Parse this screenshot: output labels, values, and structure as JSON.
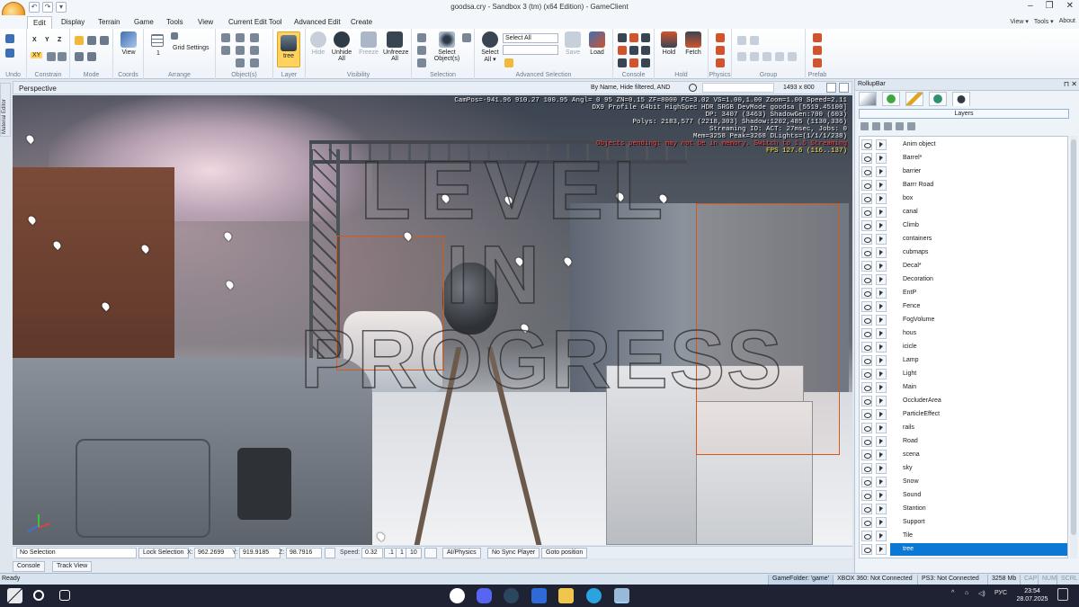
{
  "window": {
    "title": "goodsa.cry - Sandbox 3 (tm) (x64 Edition) - GameClient"
  },
  "ribbon": {
    "tabs": [
      "Edit",
      "Display",
      "Terrain",
      "Game",
      "Tools",
      "View",
      "Current Edit Tool",
      "Advanced Edit",
      "Create"
    ],
    "right_items": [
      "View ▾",
      "Tools ▾",
      "About"
    ],
    "groups": {
      "undo": "Undo",
      "constrain": "Constrain",
      "mode": "Mode",
      "coords": "Coords",
      "arrange": "Arrange",
      "objects": "Object(s)",
      "layer": "Layer",
      "visibility": "Visibility",
      "selection": "Selection",
      "advanced_selection": "Advanced Selection",
      "console": "Console",
      "hold": "Hold",
      "physics": "Physics",
      "group": "Group",
      "prefab": "Prefab"
    },
    "buttons": {
      "view": "View",
      "grid_settings": "Grid Settings",
      "one": "1",
      "tree": "tree",
      "hide": "Hide",
      "unhide_all_1": "Unhide",
      "unhide_all_2": "All",
      "freeze": "Freeze",
      "unfreeze_all_1": "Unfreeze",
      "unfreeze_all_2": "All",
      "select_objects_1": "Select",
      "select_objects_2": "Object(s)",
      "select_all_1": "Select",
      "select_all_2": "All ▾",
      "save": "Save",
      "load": "Load",
      "hold": "Hold",
      "fetch": "Fetch"
    },
    "select_all_combo": "Select All",
    "xyz": [
      "X",
      "Y",
      "Z"
    ],
    "xy": "XY"
  },
  "viewport": {
    "header": {
      "perspective": "Perspective",
      "filter": "By Name, Hide filtered, AND",
      "resolution": "1493 x 800"
    },
    "side_tab": "Material Editor",
    "debug_lines": [
      "CamPos=-941.96 910.27 100.95 Angl= 0  95 ZN=0.15 ZF=8000 FC=3.02 VS=1.00,1.00 Zoom=1.00 Speed=2.11",
      "DX9 Profile 64bit HighSpec HDR SRGB DevMode goodsa [5519.45100]",
      "DP: 3407 (3463) ShadowGen:700 (603)",
      "Polys: 2183,577 (2218,303) Shadow:1202,485 (1130,336)",
      "Streaming IO: ACT: 27msec, Jobs: 0",
      "Mem=3258 Peak=3268 DLights=(1/1/1/238)"
    ],
    "debug_warning": "Objects pending: may not be in memory. Switch to 1.5 Streaming",
    "fps": "FPS 127.6 (116..137)",
    "watermark": [
      "LEVEL",
      "IN",
      "PROGRESS"
    ]
  },
  "statusline": {
    "selection": "No Selection",
    "lock_selection": "Lock Selection",
    "x_label": "X:",
    "x_value": "962.2699",
    "y_label": "Y:",
    "y_value": "919.9185",
    "z_label": "Z:",
    "z_value": "98.7916",
    "speed_label": "Speed:",
    "speed_value": "0.32",
    "speed_presets": [
      ".1",
      "1",
      "10"
    ],
    "ai_physics": "AI/Physics",
    "no_sync_player": "No Sync Player",
    "goto_position": "Goto position"
  },
  "bottom_tabs": [
    "Console",
    "Track View"
  ],
  "app_status": {
    "ready": "Ready",
    "game_folder": "GameFolder: 'game'",
    "xbox": "XBOX 360: Not Connected",
    "ps3": "PS3: Not Connected",
    "memory": "3258 Mb",
    "cap": "CAP",
    "num": "NUM",
    "scrl": "SCRL"
  },
  "rollup": {
    "title": "RollupBar",
    "layers_header": "Layers",
    "layers": [
      "Anim object",
      "Barrel*",
      "barrier",
      "Barrr Road",
      "box",
      "canal",
      "Climb",
      "containers",
      "cubmaps",
      "Decal*",
      "Decoration",
      "EntP",
      "Fence",
      "FogVolume",
      "hous",
      "icicle",
      "Lamp",
      "Light",
      "Main",
      "OccluderArea",
      "ParticleEffect",
      "rails",
      "Road",
      "scena",
      "sky",
      "Snow",
      "Sound",
      "Stantion",
      "Support",
      "Tile",
      "tree"
    ],
    "selected_layer": "tree"
  },
  "taskbar": {
    "language": "РУС",
    "time": "23:54",
    "date": "28.07.2025"
  },
  "colors": {
    "accent": "#0b78d4",
    "ribbon_bg": "#ffffff",
    "selected_button": "#ffd35e",
    "taskbar": "#1e2233"
  }
}
